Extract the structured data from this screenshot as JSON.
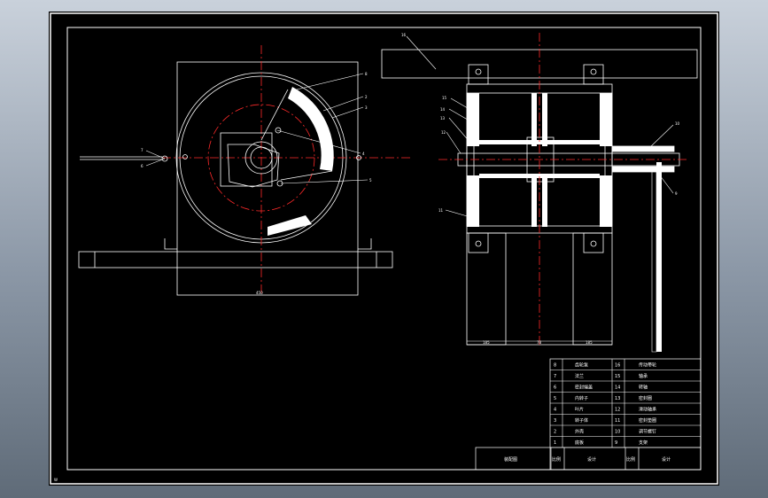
{
  "viewport": {
    "background": "#000000",
    "line_color": "#ffffff",
    "centerline_color": "#ff2a2a"
  },
  "parts_list": {
    "rows": [
      {
        "no_left": "8",
        "name_left": "齿轮泵",
        "no_right": "16",
        "name_right": "传动带轮"
      },
      {
        "no_left": "7",
        "name_left": "法兰",
        "no_right": "15",
        "name_right": "轴承"
      },
      {
        "no_left": "6",
        "name_left": "密封端盖",
        "no_right": "14",
        "name_right": "转轴"
      },
      {
        "no_left": "5",
        "name_left": "内转子",
        "no_right": "13",
        "name_right": "密封圈"
      },
      {
        "no_left": "4",
        "name_left": "叶片",
        "no_right": "12",
        "name_right": "滑动轴承"
      },
      {
        "no_left": "3",
        "name_left": "转子体",
        "no_right": "11",
        "name_right": "密封垫圈"
      },
      {
        "no_left": "2",
        "name_left": "外壳",
        "no_right": "10",
        "name_right": "调节螺钉"
      },
      {
        "no_left": "1",
        "name_left": "底板",
        "no_right": "9",
        "name_right": "支架"
      }
    ],
    "footer": {
      "title": "装配图",
      "label_a": "比例",
      "value_a": "设计",
      "label_b": "比例",
      "value_b": "设计"
    }
  },
  "dimensions": {
    "left_width": "450",
    "right_a": "185",
    "right_b": "78",
    "right_c": "185"
  },
  "corner_mark": "W"
}
